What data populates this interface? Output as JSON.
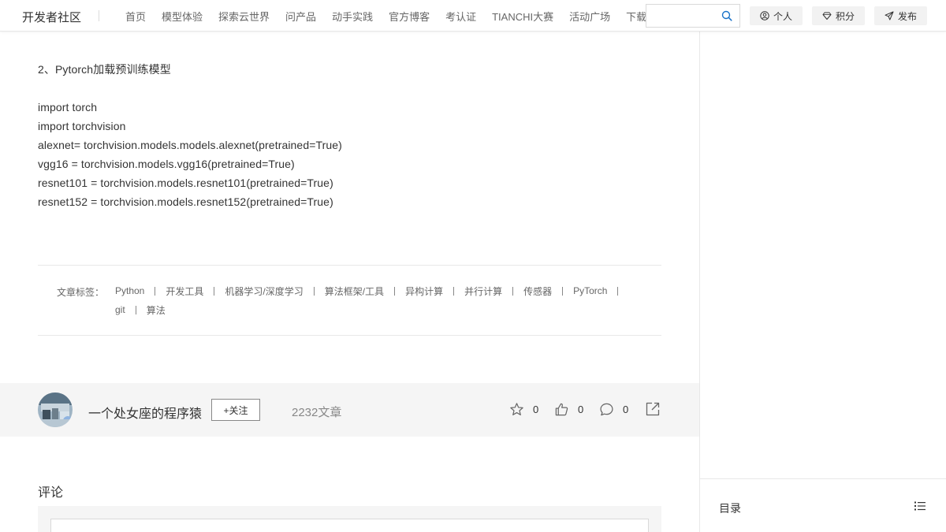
{
  "header": {
    "logo": "开发者社区",
    "nav": [
      "首页",
      "模型体验",
      "探索云世界",
      "问产品",
      "动手实践",
      "官方博客",
      "考认证",
      "TIANCHI大赛",
      "活动广场",
      "下载"
    ],
    "search_placeholder": "",
    "personal_label": "个人",
    "points_label": "积分",
    "publish_label": "发布"
  },
  "article": {
    "lines": [
      "2、Pytorch加载预训练模型",
      "",
      "import torch",
      "import torchvision",
      "alexnet= torchvision.models.models.alexnet(pretrained=True)",
      "vgg16 = torchvision.models.vgg16(pretrained=True)",
      "resnet101 = torchvision.models.resnet101(pretrained=True)",
      "resnet152 = torchvision.models.resnet152(pretrained=True)"
    ]
  },
  "tags": {
    "label": "文章标签：",
    "row1": [
      "Python",
      "开发工具",
      "机器学习/深度学习",
      "算法框架/工具",
      "异构计算",
      "并行计算",
      "传感器",
      "PyTorch"
    ],
    "row2": [
      "git",
      "算法"
    ]
  },
  "author": {
    "name": "一个处女座的程序猿",
    "follow_label": "+关注",
    "article_count": "2232文章",
    "favorites": "0",
    "likes": "0",
    "comments": "0"
  },
  "comments": {
    "title": "评论"
  },
  "sidebar": {
    "toc_label": "目录"
  }
}
